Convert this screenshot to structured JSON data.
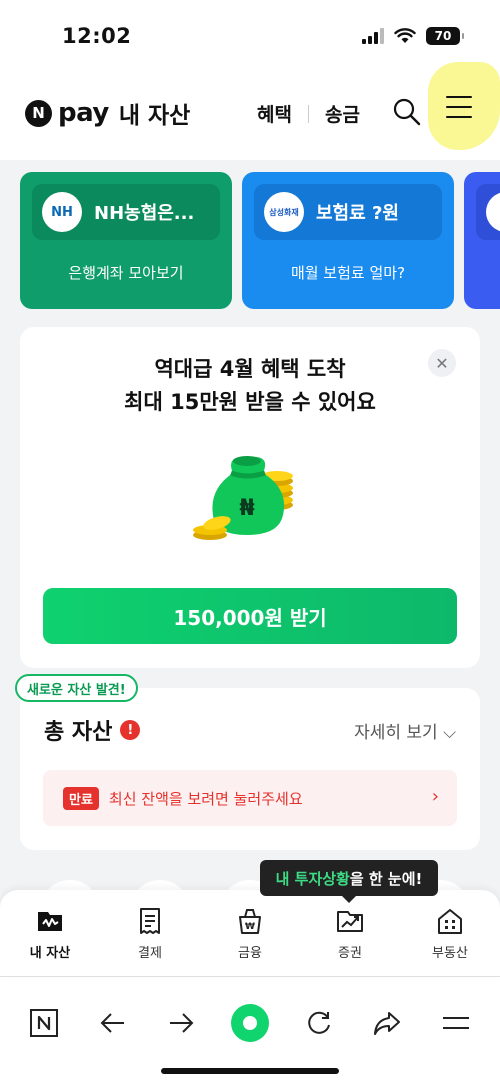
{
  "status": {
    "time": "12:02",
    "battery": "70"
  },
  "header": {
    "logo_letter": "N",
    "brand": "pay",
    "title": "내 자산",
    "nav": [
      "혜택",
      "송금"
    ]
  },
  "cards": [
    {
      "logo": "NH",
      "name": "NH농협은...",
      "sub": "은행계좌 모아보기",
      "bg": "#0f9d6b",
      "top_bg": "#0b8a5d",
      "logo_color": "#0a6ab5"
    },
    {
      "logo": "삼성화재",
      "name": "보험료 ?원",
      "sub": "매월 보험료 얼마?",
      "bg": "#1a8cf0",
      "top_bg": "#1479d6",
      "logo_color": "#1a5bc4"
    }
  ],
  "promo": {
    "title_line1": "역대급 4월 혜택 도착",
    "title_line2": "최대 15만원 받을 수 있어요",
    "button": "150,000원 받기"
  },
  "asset": {
    "badge": "새로운 자산 발견!",
    "title": "총 자산",
    "alert": "!",
    "more": "자세히 보기",
    "expire_tag": "만료",
    "expire_text": "최신 잔액을 보려면 눌러주세요"
  },
  "tooltip": {
    "highlight": "내 투자상황",
    "rest": "을 한 눈에!"
  },
  "tabs": [
    {
      "label": "내 자산",
      "icon": "wallet-icon",
      "active": true
    },
    {
      "label": "결제",
      "icon": "receipt-icon",
      "active": false
    },
    {
      "label": "금융",
      "icon": "bag-icon",
      "active": false
    },
    {
      "label": "증권",
      "icon": "chart-icon",
      "active": false
    },
    {
      "label": "부동산",
      "icon": "building-icon",
      "active": false
    }
  ],
  "colors": {
    "accent": "#0fd16f",
    "alert": "#e5322d",
    "highlight": "#f8f78a"
  }
}
